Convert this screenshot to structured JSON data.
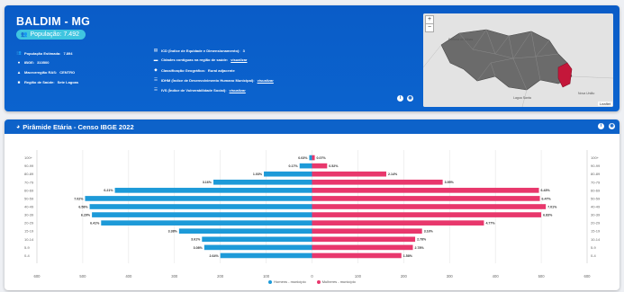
{
  "header": {
    "title": "BALDIM - MG",
    "population_badge": "População: 7.492",
    "rows_left": [
      {
        "glyph": "👥",
        "label": "População Estimada:",
        "value": "7.894"
      },
      {
        "glyph": "●",
        "label": "IBGE:",
        "value": "310500"
      },
      {
        "glyph": "▲",
        "label": "Macrorregião RAS:",
        "value": "CENTRO"
      },
      {
        "glyph": "■",
        "label": "Região de Saúde:",
        "value": "Sete Lagoas"
      }
    ],
    "rows_right": [
      {
        "glyph": "▤",
        "label": "ICD (Índice de Equidade e Dimensionamento):",
        "value": "3",
        "link": ""
      },
      {
        "glyph": "▬",
        "label": "Cidades contíguas na região de saúde:",
        "value": "",
        "link": "visualizar"
      },
      {
        "glyph": "◆",
        "label": "Classificação Geográfica:",
        "value": "Rural adjacente",
        "link": ""
      },
      {
        "glyph": "☰",
        "label": "IDHM (Índice de Desenvolvimento Humano Municipal):",
        "value": "",
        "link": "visualizar"
      },
      {
        "glyph": "☰",
        "label": "IVS (Índice de Vulnerabilidade Social):",
        "value": "",
        "link": "visualizar"
      }
    ],
    "info_icon": "i",
    "eye_icon": "◉"
  },
  "map": {
    "zoom_in": "+",
    "zoom_out": "−",
    "attribution": "Leaflet",
    "label_a": "Fortuna de Minas",
    "label_b": "Lagoa Santa",
    "label_c": "Nova União"
  },
  "pyramid": {
    "title": "Pirâmide Etária - Censo IBGE 2022",
    "info_icon": "i",
    "eye_icon": "◉",
    "legend_men": "Homens - município",
    "legend_women": "Mulheres - município",
    "color_men": "#1d9ad8",
    "color_women": "#e8376c"
  },
  "chart_data": {
    "type": "bar",
    "orientation": "horizontal-pyramid",
    "categories": [
      "100+",
      "90-99",
      "80-89",
      "70-79",
      "60-69",
      "50-59",
      "40-49",
      "30-39",
      "20-29",
      "15-19",
      "10-14",
      "5-9",
      "0-4"
    ],
    "series": [
      {
        "name": "Homens - município",
        "values": [
          -6,
          -27,
          -105,
          -215,
          -430,
          -495,
          -485,
          -480,
          -460,
          -290,
          -240,
          -235,
          -200
        ],
        "labels": [
          "0.03%",
          "0.17%",
          "1.03%",
          "3.16%",
          "6.21%",
          "7.02%",
          "6.58%",
          "6.29%",
          "6.41%",
          "3.38%",
          "3.61%",
          "3.08%",
          "2.64%"
        ]
      },
      {
        "name": "Mulheres - município",
        "values": [
          6,
          33,
          162,
          285,
          495,
          497,
          510,
          500,
          375,
          240,
          225,
          220,
          195
        ],
        "labels": [
          "0.07%",
          "0.52%",
          "2.14%",
          "3.95%",
          "6.43%",
          "6.47%",
          "7.01%",
          "6.83%",
          "4.77%",
          "3.16%",
          "2.78%",
          "2.78%",
          "1.58%"
        ]
      }
    ],
    "xticks": [
      -600,
      -500,
      -400,
      -300,
      -200,
      -100,
      0,
      100,
      200,
      300,
      400,
      500,
      600
    ],
    "xtick_labels": [
      "600",
      "500",
      "400",
      "300",
      "200",
      "100",
      "0",
      "100",
      "200",
      "300",
      "400",
      "500",
      "600"
    ],
    "xlim": [
      -600,
      600
    ],
    "grid": true,
    "legend_position": "bottom-center"
  }
}
